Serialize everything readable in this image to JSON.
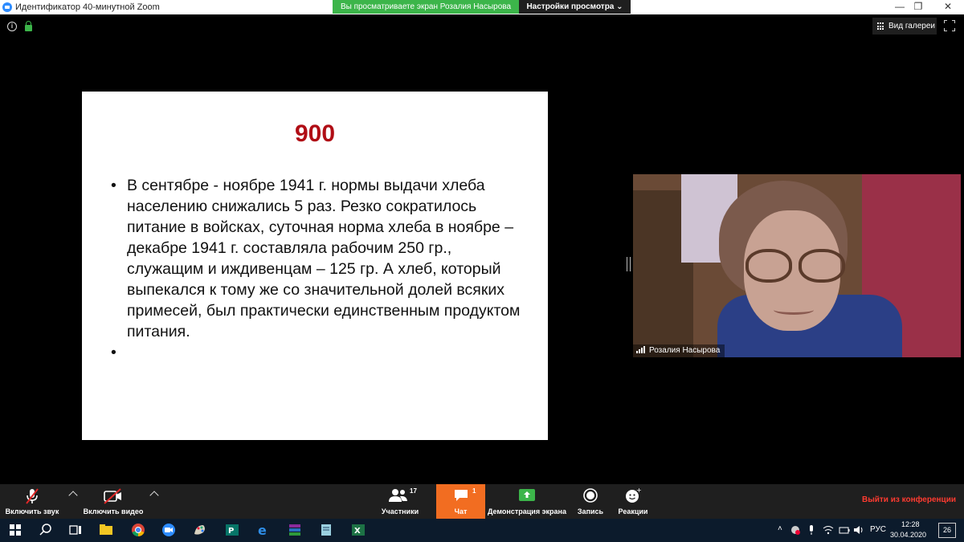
{
  "window": {
    "title": "Идентификатор 40-минутной Zoom",
    "controls": {
      "minimize": "—",
      "maximize": "❐",
      "close": "✕"
    }
  },
  "share_banner": {
    "text": "Вы просматриваете экран Розалия Насырова"
  },
  "view_settings": {
    "label": "Настройки просмотра ⌄"
  },
  "gallery_view": {
    "label": "Вид галереи"
  },
  "slide": {
    "title": "900",
    "bullets": [
      "В сентябре - ноябре 1941 г. нормы выдачи хлеба населению снижались 5 раз. Резко сократилось питание в войсках, суточная норма хлеба в ноябре – декабре 1941 г. составляла рабочим 250 гр., служащим и иждивенцам – 125 гр. А хлеб, который выпекался к тому же со значительной долей всяких примесей, был практически единственным продуктом питания.",
      ""
    ]
  },
  "video": {
    "participant_name": "Розалия Насырова"
  },
  "toolbar": {
    "unmute_label": "Включить звук",
    "start_video_label": "Включить видео",
    "participants_label": "Участники",
    "participants_count": "17",
    "chat_label": "Чат",
    "chat_badge": "1",
    "share_screen_label": "Демонстрация экрана",
    "record_label": "Запись",
    "reactions_label": "Реакции",
    "leave_label": "Выйти из конференции"
  },
  "taskbar": {
    "lang": "РУС",
    "time": "12:28",
    "date": "30.04.2020",
    "notification_count": "26",
    "apps": [
      "windows-start-icon",
      "search-icon",
      "task-view-icon",
      "file-explorer-icon",
      "chrome-icon",
      "zoom-icon",
      "paint-icon",
      "publisher-icon",
      "edge-icon",
      "winrar-icon",
      "notepad-icon",
      "excel-icon"
    ]
  },
  "colors": {
    "share_banner": "#3cb54a",
    "chat_active": "#f26d21",
    "slide_title": "#b00d15",
    "leave": "#ff3b30",
    "taskbar": "#0c1b2c"
  }
}
